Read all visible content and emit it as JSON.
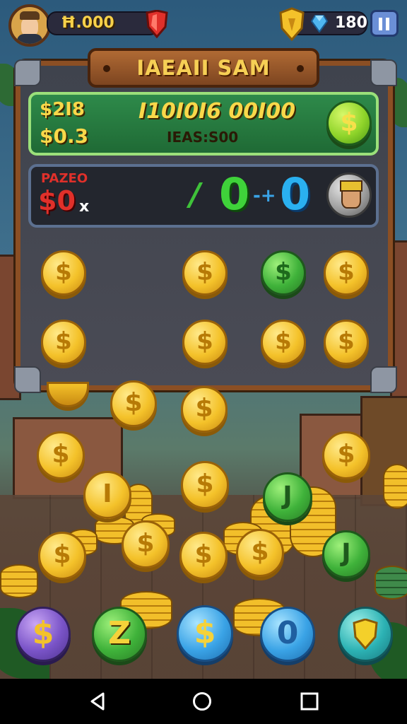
{
  "hud": {
    "coin_count": "Ħ.000",
    "gem_count": "180",
    "avatar_icon": "player-avatar",
    "ruby_icon": "ruby-shield-icon",
    "shield_icon": "gold-shield-icon",
    "gem_icon": "blue-gem-icon",
    "pause_icon": "pause-icon"
  },
  "board": {
    "title": "IAEAII SAM",
    "bank": {
      "line1": "$2I8",
      "line2": "$0.3",
      "big_number": "I10I0I6 00I00",
      "sub_label": "IEAS:S00",
      "coin_icon": "dollar-coin-icon"
    },
    "match": {
      "label": "PAZEO",
      "amount": "$0",
      "multiplier": "x",
      "slash": "/",
      "left_value": "0",
      "operator": "-+",
      "right_value": "0",
      "opponent_icon": "opponent-avatar-icon"
    }
  },
  "bottom_buttons": [
    {
      "name": "purple-dollar-button",
      "label": "$"
    },
    {
      "name": "green-z-button",
      "label": "Z"
    },
    {
      "name": "blue-dollar-button",
      "label": "$"
    },
    {
      "name": "blue-zero-button",
      "label": "0"
    },
    {
      "name": "teal-shield-button",
      "label": "shield"
    }
  ],
  "coin_symbols": {
    "dollar": "$",
    "letter_j": "J",
    "letter_i": "I"
  },
  "nav": {
    "back_icon": "back-icon",
    "home_icon": "home-icon",
    "recents_icon": "recents-icon"
  },
  "colors": {
    "gold": "#f4c22a",
    "green": "#3fb23a",
    "blue": "#3aa3e6",
    "frame": "#8b4f24",
    "text_yellow": "#f9d84a",
    "red": "#e0302a"
  }
}
